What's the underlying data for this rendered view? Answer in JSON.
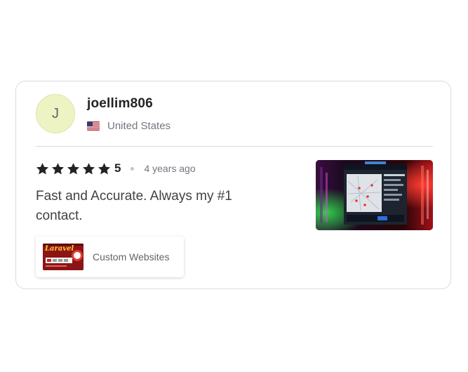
{
  "review": {
    "avatar_initial": "J",
    "username": "joellim806",
    "country": "United States",
    "country_flag_icon": "us-flag-icon",
    "rating": 5,
    "rating_label": "5",
    "time_ago": "4 years ago",
    "text": "Fast and Accurate. Always my #1 contact.",
    "gig": {
      "label": "Custom Websites",
      "thumbnail_text": "Laravel"
    }
  },
  "colors": {
    "star": "#222325",
    "avatar_bg": "#eef3c4",
    "border": "#dadbdd",
    "muted_text": "#74767e",
    "body_text": "#404145"
  }
}
